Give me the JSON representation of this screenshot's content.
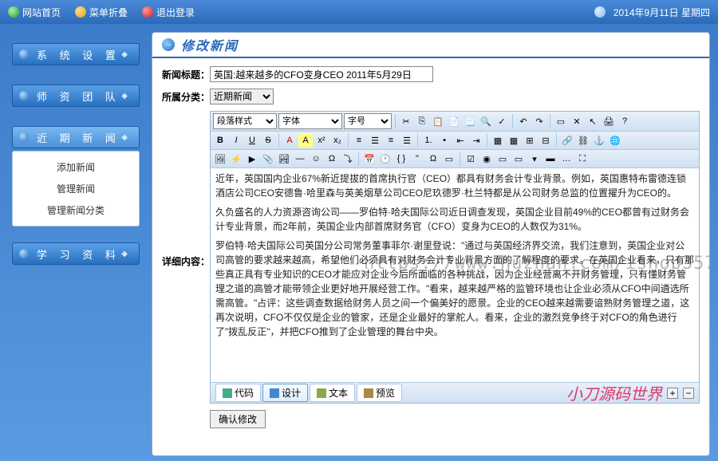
{
  "topbar": {
    "home": "网站首页",
    "collapse": "菜单折叠",
    "logout": "退出登录",
    "date": "2014年9月11日 星期四"
  },
  "sidebar": {
    "menus": [
      {
        "label": "系 统 设 置"
      },
      {
        "label": "师 资 团 队"
      },
      {
        "label": "近 期 新 闻"
      },
      {
        "label": "学 习 资 料"
      }
    ],
    "news_submenu": [
      "添加新闻",
      "管理新闻",
      "管理新闻分类"
    ]
  },
  "page": {
    "title": "修改新闻",
    "labels": {
      "title": "新闻标题：",
      "category": "所属分类：",
      "content": "详细内容："
    },
    "title_value": "英国:越来越多的CFO变身CEO 2011年5月29日",
    "category_value": "近期新闻",
    "editor_selects": {
      "paragraph": "段落样式",
      "font": "字体",
      "size": "字号"
    },
    "editor_tabs": {
      "code": "代码",
      "design": "设计",
      "text": "文本",
      "preview": "预览"
    },
    "submit": "确认修改",
    "content_paragraphs": [
      "近年，英国国内企业67%新近提拔的首席执行官（CEO）都具有财务会计专业背景。例如，英国惠特布雷德连锁酒店公司CEO安德鲁·哈里森与英美烟草公司CEO尼玖德罗·杜兰特都是从公司财务总监的位置擢升为CEO的。",
      "久负盛名的人力资源咨询公司——罗伯特·哈夫国际公司近日调查发现，英国企业目前49%的CEO都曾有过财务会计专业背景，而2年前，英国企业内部首席财务官（CFO）变身为CEO的人数仅为31%。",
      "罗伯特·哈夫国际公司英国分公司常务董事菲尔·谢里登说：\"通过与英国经济界交流，我们注意到，英国企业对公司高管的要求越来越高，希望他们必须具有对财务会计专业背景方面的了解程度的要求。在英国企业看来，只有那些真正具有专业知识的CEO才能应对企业今后所面临的各种挑战，因为企业经营离不开财务管理，只有懂财务管理之道的高管才能带领企业更好地开展经营工作。\"看来，越来越严格的监管环境也让企业必须从CFO中间遴选所需高管。\"占评：这些调查数据给财务人员之间一个偏美好的愿景。企业的CEO越来越需要谙熟财务管理之道，这再次说明，CFO不仅仅是企业的管家，还是企业最好的掌舵人。看来，企业的激烈竞争终于对CFO的角色进行了\"拨乱反正\"，并把CFO推到了企业管理的舞台中央。"
    ]
  },
  "watermark": {
    "footer": "小刀源码世界",
    "overlay": "https://www.huzhan.com/ishop3572"
  }
}
